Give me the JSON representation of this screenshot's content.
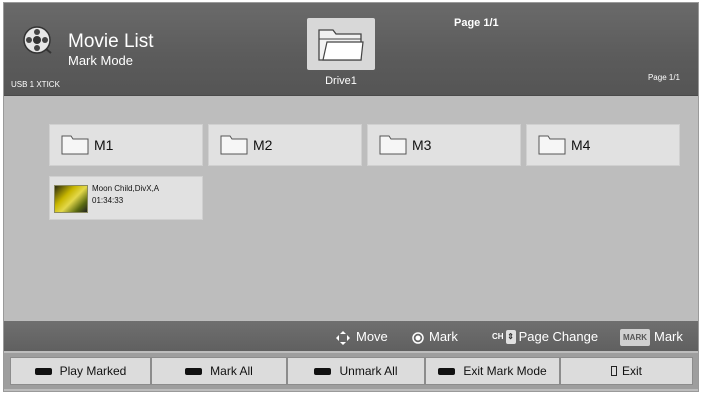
{
  "header": {
    "title": "Movie List",
    "subtitle": "Mark Mode",
    "device": "USB 1 XTICK",
    "drive_label": "Drive1",
    "page_top": "Page 1/1",
    "page_right": "Page 1/1",
    "app_icon": "film-reel-icon",
    "drive_icon": "folder-icon"
  },
  "folders": [
    {
      "name": "M1"
    },
    {
      "name": "M2"
    },
    {
      "name": "M3"
    },
    {
      "name": "M4"
    }
  ],
  "files": [
    {
      "name": "Moon Child,DivX,A",
      "duration": "01:34:33",
      "thumb_icon": "movie-thumbnail"
    }
  ],
  "hints": {
    "move": "Move",
    "mark": "Mark",
    "ch_label": "CH",
    "page_change": "Page Change",
    "mark_key": "MARK",
    "mark2": "Mark"
  },
  "buttons": {
    "play_marked": "Play Marked",
    "mark_all": "Mark All",
    "unmark_all": "Unmark All",
    "exit_mark_mode": "Exit Mark Mode",
    "exit": "Exit"
  }
}
